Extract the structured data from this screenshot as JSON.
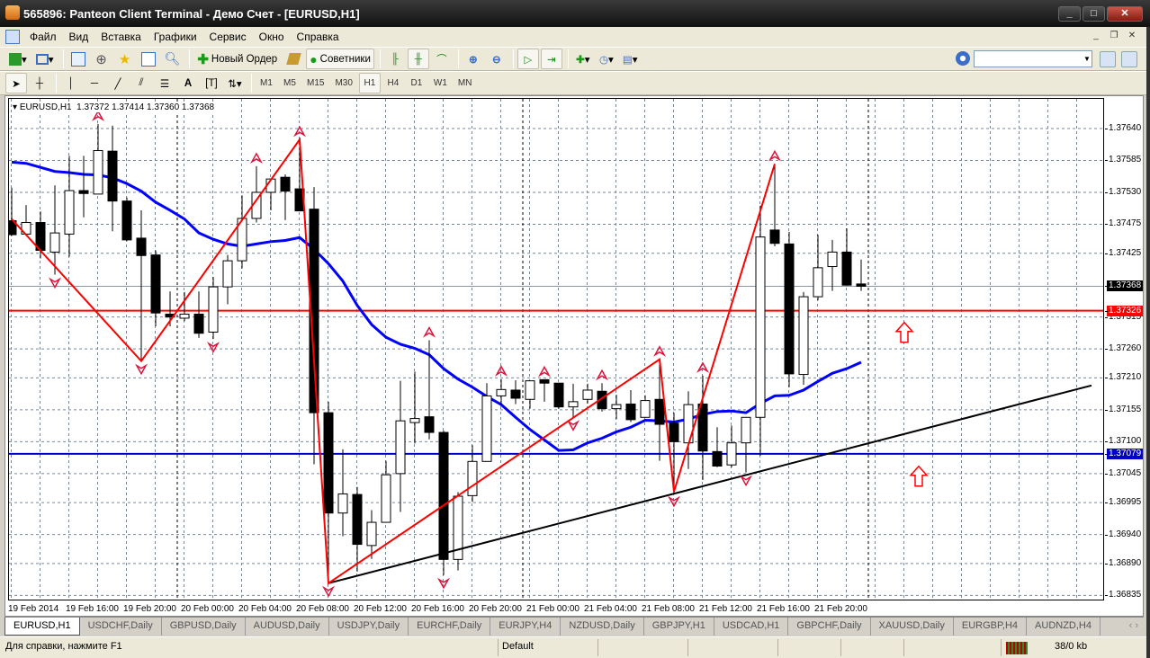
{
  "window": {
    "title": "565896: Panteon Client Terminal - Демо Счет - [EURUSD,H1]",
    "controls": [
      "_",
      "□",
      "✕"
    ]
  },
  "menu": [
    "Файл",
    "Вид",
    "Вставка",
    "Графики",
    "Сервис",
    "Окно",
    "Справка"
  ],
  "toolbar": {
    "new_order": "Новый Ордер",
    "experts": "Советники",
    "search_placeholder": ""
  },
  "timeframes": [
    "M1",
    "M5",
    "M15",
    "M30",
    "H1",
    "H4",
    "D1",
    "W1",
    "MN"
  ],
  "active_timeframe": "H1",
  "chart": {
    "legend": "EURUSD,H1  1.37372 1.37414 1.37360 1.37368"
  },
  "tabs": [
    "EURUSD,H1",
    "USDCHF,Daily",
    "GBPUSD,Daily",
    "AUDUSD,Daily",
    "USDJPY,Daily",
    "EURCHF,Daily",
    "EURJPY,H4",
    "NZDUSD,Daily",
    "GBPJPY,H1",
    "USDCAD,H1",
    "GBPCHF,Daily",
    "XAUUSD,Daily",
    "EURGBP,H4",
    "AUDNZD,H4"
  ],
  "status": {
    "help": "Для справки, нажмите F1",
    "profile": "Default",
    "traffic": "38/0 kb"
  },
  "chart_data": {
    "type": "candlestick",
    "symbol": "EURUSD",
    "timeframe": "H1",
    "y_range": [
      1.36835,
      1.3764
    ],
    "y_ticks": [
      "1.37640",
      "1.37585",
      "1.37530",
      "1.37475",
      "1.37425",
      "1.37315",
      "1.37260",
      "1.37210",
      "1.37155",
      "1.37100",
      "1.37045",
      "1.36995",
      "1.36940",
      "1.36890",
      "1.36835"
    ],
    "x_tick_labels": [
      "19 Feb 2014",
      "19 Feb 16:00",
      "19 Feb 20:00",
      "20 Feb 00:00",
      "20 Feb 04:00",
      "20 Feb 08:00",
      "20 Feb 12:00",
      "20 Feb 16:00",
      "20 Feb 20:00",
      "21 Feb 00:00",
      "21 Feb 04:00",
      "21 Feb 08:00",
      "21 Feb 12:00",
      "21 Feb 16:00",
      "21 Feb 20:00"
    ],
    "x_tick_every_bars": 4,
    "day_separators_at_bar": [
      12,
      36,
      60
    ],
    "candles": [
      [
        1.37481,
        1.37538,
        1.37455,
        1.37457
      ],
      [
        1.37458,
        1.37508,
        1.37457,
        1.37478
      ],
      [
        1.37478,
        1.37497,
        1.37416,
        1.3743
      ],
      [
        1.37427,
        1.37542,
        1.37388,
        1.3746
      ],
      [
        1.37458,
        1.37593,
        1.37419,
        1.37533
      ],
      [
        1.37533,
        1.37593,
        1.37487,
        1.37528
      ],
      [
        1.37527,
        1.37648,
        1.37527,
        1.37602
      ],
      [
        1.37601,
        1.37645,
        1.37463,
        1.37515
      ],
      [
        1.37515,
        1.37521,
        1.37446,
        1.37448
      ],
      [
        1.37451,
        1.37499,
        1.37239,
        1.37421
      ],
      [
        1.37422,
        1.3743,
        1.37299,
        1.37322
      ],
      [
        1.3732,
        1.37359,
        1.37299,
        1.37315
      ],
      [
        1.37313,
        1.37358,
        1.37308,
        1.3732
      ],
      [
        1.3732,
        1.37359,
        1.37279,
        1.37287
      ],
      [
        1.37289,
        1.37384,
        1.37277,
        1.37367
      ],
      [
        1.37367,
        1.37422,
        1.37337,
        1.37412
      ],
      [
        1.37412,
        1.37525,
        1.37399,
        1.37485
      ],
      [
        1.37485,
        1.37575,
        1.37478,
        1.3753
      ],
      [
        1.3753,
        1.37553,
        1.37499,
        1.37553
      ],
      [
        1.37556,
        1.37561,
        1.37482,
        1.37532
      ],
      [
        1.37536,
        1.37621,
        1.37498,
        1.37498
      ],
      [
        1.37501,
        1.37539,
        1.37061,
        1.3715
      ],
      [
        1.3715,
        1.37169,
        1.36856,
        1.36977
      ],
      [
        1.36977,
        1.37087,
        1.36937,
        1.3701
      ],
      [
        1.37009,
        1.37022,
        1.36876,
        1.36923
      ],
      [
        1.36921,
        1.36982,
        1.36898,
        1.36961
      ],
      [
        1.36961,
        1.37067,
        1.36961,
        1.37043
      ],
      [
        1.37045,
        1.37205,
        1.36979,
        1.37136
      ],
      [
        1.37133,
        1.37221,
        1.37097,
        1.3714
      ],
      [
        1.37143,
        1.37275,
        1.37104,
        1.37116
      ],
      [
        1.37116,
        1.37119,
        1.3687,
        1.36897
      ],
      [
        1.36897,
        1.37013,
        1.36878,
        1.37006
      ],
      [
        1.37007,
        1.37094,
        1.36996,
        1.37066
      ],
      [
        1.37066,
        1.37201,
        1.37066,
        1.37179
      ],
      [
        1.37179,
        1.37208,
        1.37164,
        1.3719
      ],
      [
        1.37189,
        1.37206,
        1.37165,
        1.37175
      ],
      [
        1.37173,
        1.37205,
        1.37157,
        1.37205
      ],
      [
        1.37207,
        1.37207,
        1.37169,
        1.37201
      ],
      [
        1.37201,
        1.37201,
        1.37157,
        1.3716
      ],
      [
        1.3716,
        1.372,
        1.37142,
        1.37169
      ],
      [
        1.37173,
        1.372,
        1.37166,
        1.37189
      ],
      [
        1.37187,
        1.37201,
        1.37152,
        1.37157
      ],
      [
        1.37157,
        1.37181,
        1.37139,
        1.37164
      ],
      [
        1.37165,
        1.37189,
        1.37134,
        1.37138
      ],
      [
        1.37142,
        1.3718,
        1.37142,
        1.37171
      ],
      [
        1.37173,
        1.37242,
        1.37067,
        1.3713
      ],
      [
        1.37132,
        1.3715,
        1.37011,
        1.371
      ],
      [
        1.37098,
        1.37187,
        1.37053,
        1.37164
      ],
      [
        1.37165,
        1.37214,
        1.37034,
        1.37084
      ],
      [
        1.37083,
        1.37125,
        1.37056,
        1.37058
      ],
      [
        1.3706,
        1.37128,
        1.37056,
        1.37098
      ],
      [
        1.37098,
        1.37142,
        1.37047,
        1.37142
      ],
      [
        1.37142,
        1.37507,
        1.37076,
        1.37453
      ],
      [
        1.37465,
        1.37579,
        1.37437,
        1.37442
      ],
      [
        1.37441,
        1.37462,
        1.37194,
        1.37217
      ],
      [
        1.37216,
        1.37358,
        1.37198,
        1.3735
      ],
      [
        1.3735,
        1.37457,
        1.37344,
        1.374
      ],
      [
        1.37402,
        1.37448,
        1.3736,
        1.37427
      ],
      [
        1.37427,
        1.37468,
        1.37369,
        1.3737
      ],
      [
        1.37372,
        1.37414,
        1.3736,
        1.37368
      ]
    ],
    "candle_format": [
      "open",
      "high",
      "low",
      "close"
    ],
    "moving_average": [
      1.37582,
      1.3758,
      1.37573,
      1.37566,
      1.37564,
      1.37561,
      1.3756,
      1.37555,
      1.37545,
      1.37532,
      1.37513,
      1.37499,
      1.37484,
      1.3746,
      1.37449,
      1.37441,
      1.37437,
      1.37441,
      1.37445,
      1.37447,
      1.37452,
      1.37432,
      1.37407,
      1.37377,
      1.37335,
      1.37302,
      1.3728,
      1.37268,
      1.37261,
      1.3725,
      1.37226,
      1.37208,
      1.37194,
      1.37178,
      1.37164,
      1.37142,
      1.37121,
      1.37103,
      1.37085,
      1.37086,
      1.37098,
      1.37106,
      1.37117,
      1.37125,
      1.37137,
      1.37136,
      1.37134,
      1.37139,
      1.37147,
      1.37152,
      1.37153,
      1.3715,
      1.37166,
      1.37179,
      1.3718,
      1.37189,
      1.37204,
      1.37218,
      1.37226,
      1.37237
    ],
    "zigzag": [
      [
        0,
        1.37484
      ],
      [
        9,
        1.37239
      ],
      [
        20,
        1.37621
      ],
      [
        22,
        1.36856
      ],
      [
        45,
        1.37242
      ],
      [
        46,
        1.37014
      ],
      [
        53,
        1.37579
      ]
    ],
    "trendline": [
      [
        22,
        1.36856
      ],
      [
        75,
        1.37197
      ]
    ],
    "horizontal_lines": [
      {
        "price": "1.37326",
        "color": "#ff0000"
      },
      {
        "price": "1.37079",
        "color": "#0000cc"
      }
    ],
    "bid_line": "1.37368",
    "fractals_up": [
      6,
      17,
      20,
      29,
      34,
      37,
      41,
      45,
      48,
      53
    ],
    "fractals_down": [
      3,
      9,
      14,
      22,
      30,
      39,
      46,
      51
    ],
    "arrow_objects": [
      [
        62,
        1.37287
      ],
      [
        63,
        1.37039
      ]
    ]
  }
}
